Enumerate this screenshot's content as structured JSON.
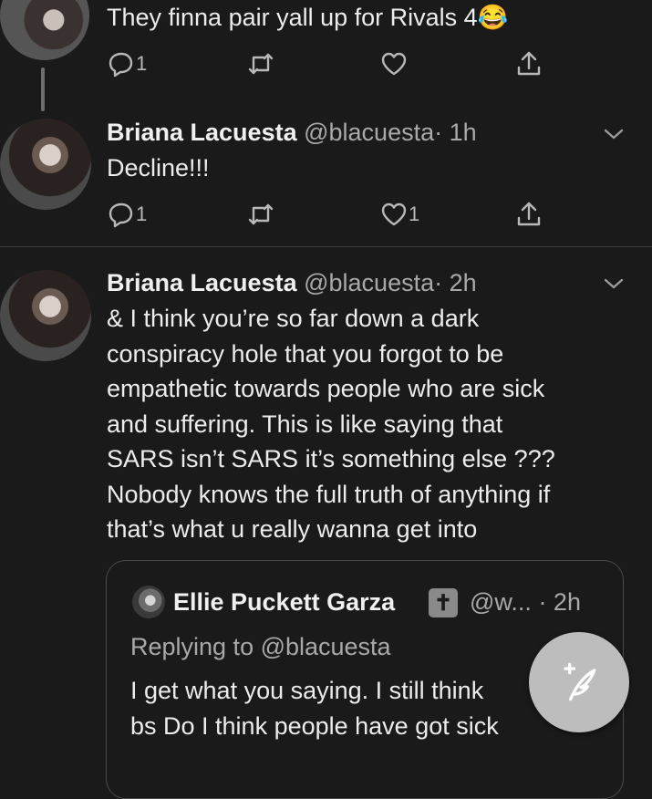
{
  "tweet_top": {
    "text": "They finna pair yall up for Rivals 4",
    "emoji": "😂",
    "replies": "1",
    "retweets": "",
    "likes": ""
  },
  "tweet_reply": {
    "name": "Briana Lacuesta",
    "handle": "@blacuesta",
    "time": "· 1h",
    "text": "Decline!!!",
    "replies": "1",
    "retweets": "",
    "likes": "1"
  },
  "tweet_main": {
    "name": "Briana Lacuesta",
    "handle": "@blacuesta",
    "time": "· 2h",
    "lines": [
      "& I think you’re so far down a dark",
      "conspiracy hole that you forgot to be",
      "empathetic towards people who are sick",
      "and suffering. This is like saying that",
      "SARS isn’t SARS it’s something else ???",
      "Nobody knows the full truth of anything if",
      "that’s what u really wanna get into"
    ],
    "quote": {
      "name": "Ellie Puckett Garza",
      "badge": "✝",
      "handle": "@w...",
      "time": "· 2h",
      "replying": "Replying to @blacuesta",
      "lines": [
        "I get what you saying. I still think",
        "bs Do I think people have got sick"
      ]
    }
  },
  "fab": {
    "icon": "compose-feather-icon",
    "color": "#bdbdbd"
  },
  "colors": {
    "background": "#1a1a1a",
    "text": "#ececec",
    "muted": "#a9a9a9"
  }
}
